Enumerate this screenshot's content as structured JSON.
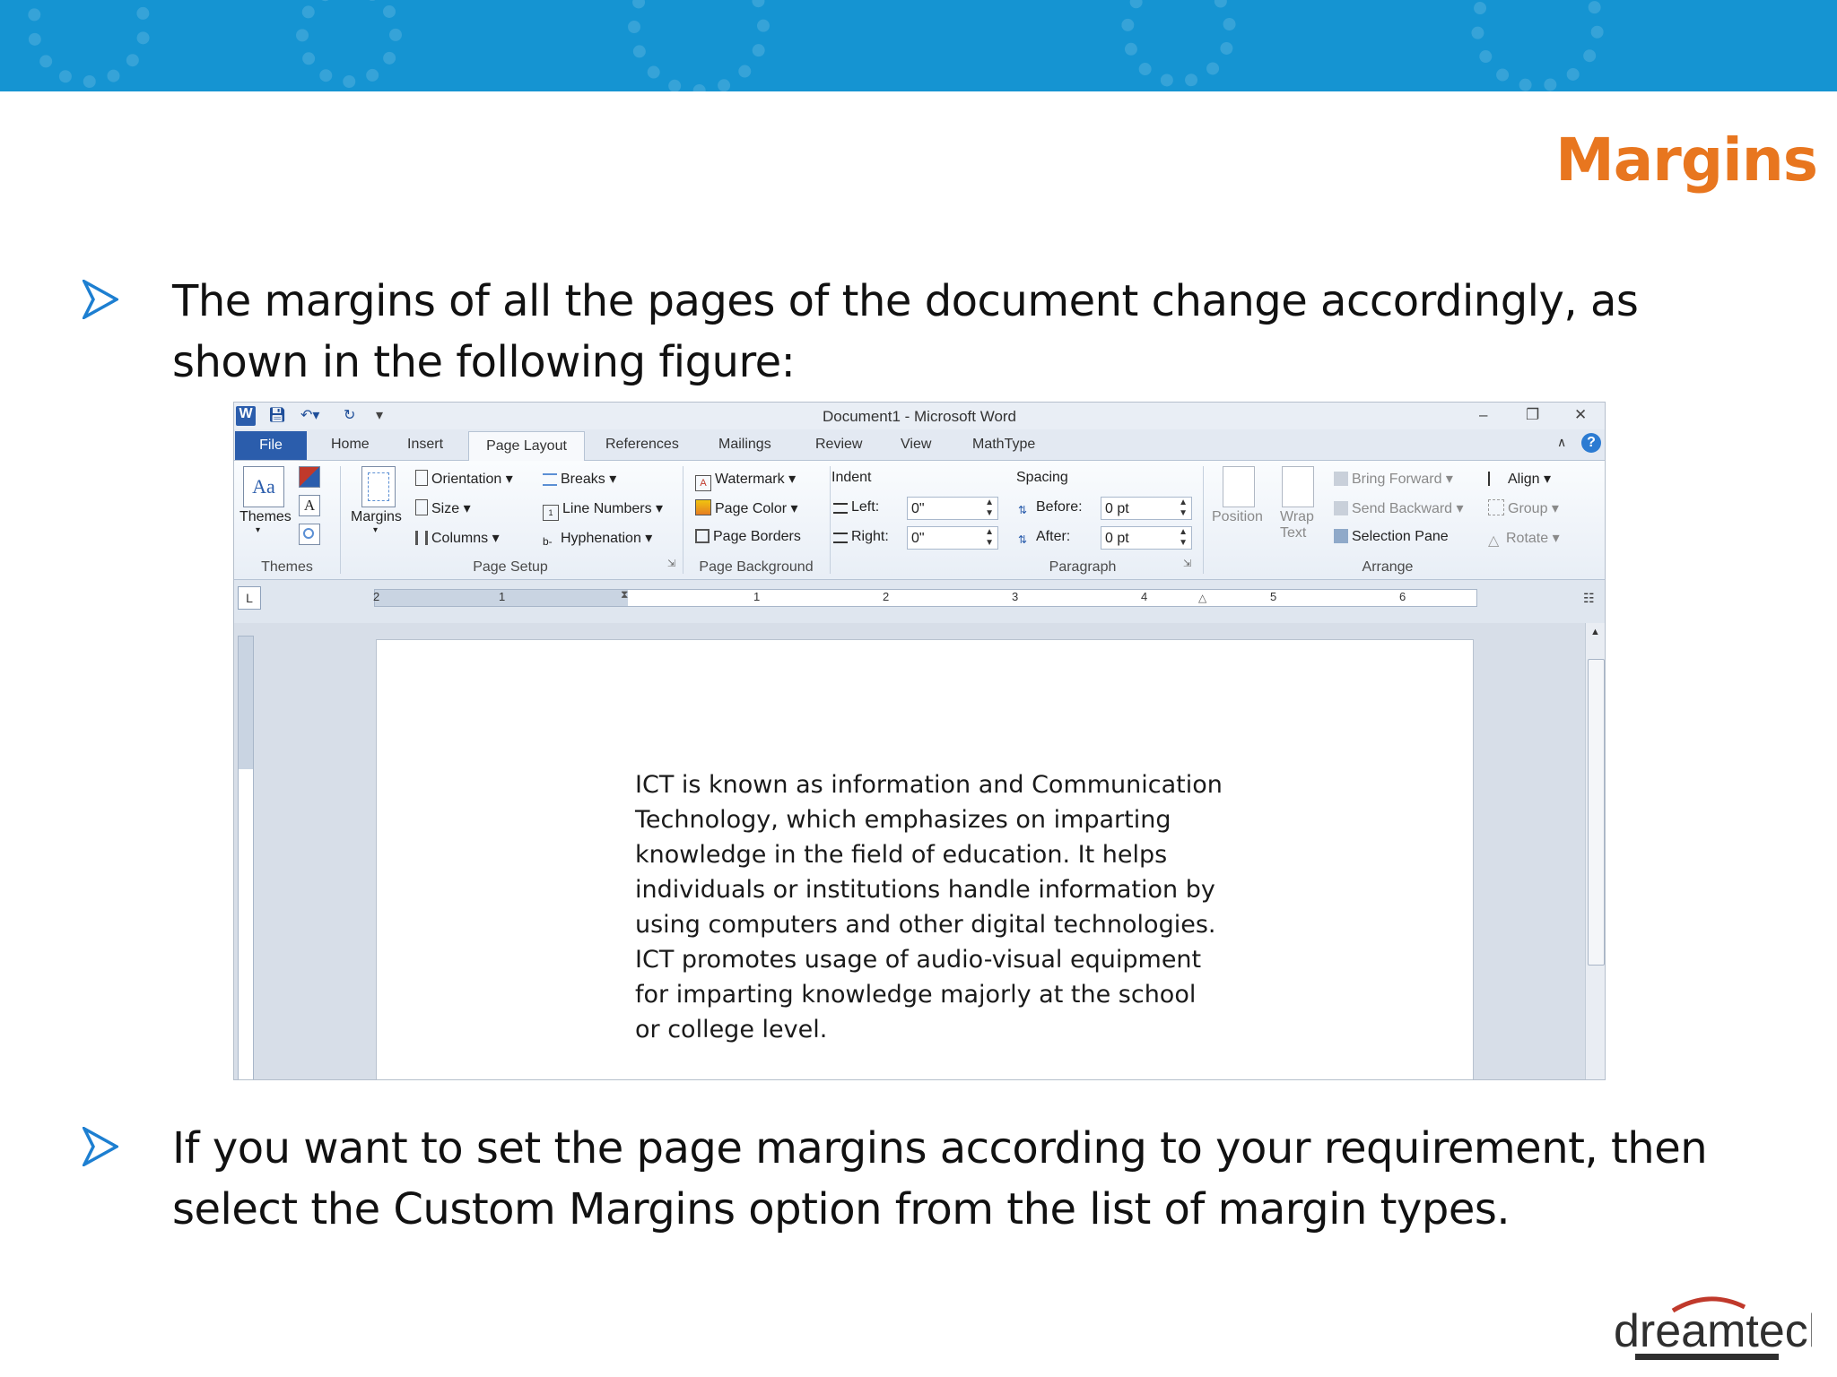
{
  "slide": {
    "title": "Margins",
    "bullets": [
      "The margins of all the pages of the document change accordingly, as shown in the following figure:",
      "If you want to set the page margins according to your requirement, then select the Custom Margins option from the list of margin types."
    ],
    "logo_text": "dreamtech",
    "colors": {
      "banner": "#1594d2",
      "title": "#e8761f",
      "bullet": "#1d7fd1"
    }
  },
  "word": {
    "window_title": "Document1  -  Microsoft Word",
    "tabs": {
      "file": "File",
      "home": "Home",
      "insert": "Insert",
      "page_layout": "Page Layout",
      "references": "References",
      "mailings": "Mailings",
      "review": "Review",
      "view": "View",
      "mathtype": "MathType"
    },
    "ribbon": {
      "themes": {
        "themes": "Themes",
        "group": "Themes"
      },
      "page_setup": {
        "margins": "Margins",
        "orientation": "Orientation",
        "size": "Size",
        "columns": "Columns",
        "breaks": "Breaks",
        "line_numbers": "Line Numbers",
        "hyphenation": "Hyphenation",
        "group": "Page Setup"
      },
      "page_background": {
        "watermark": "Watermark",
        "page_color": "Page Color",
        "page_borders": "Page Borders",
        "group": "Page Background"
      },
      "paragraph": {
        "indent": "Indent",
        "left_label": "Left:",
        "left_value": "0\"",
        "right_label": "Right:",
        "right_value": "0\"",
        "spacing": "Spacing",
        "before_label": "Before:",
        "before_value": "0 pt",
        "after_label": "After:",
        "after_value": "0 pt",
        "group": "Paragraph"
      },
      "arrange": {
        "position": "Position",
        "wrap_text": "Wrap",
        "wrap_text_2": "Text",
        "bring_forward": "Bring Forward",
        "send_backward": "Send Backward",
        "selection_pane": "Selection Pane",
        "align": "Align",
        "group_btn": "Group",
        "rotate": "Rotate",
        "group": "Arrange"
      }
    },
    "ruler_numbers": [
      "2",
      "1",
      "1",
      "2",
      "3",
      "4",
      "5",
      "6"
    ],
    "document_text": "ICT is known as information and Communication Technology, which emphasizes on imparting knowledge in the field of education. It helps individuals or institutions handle information by using computers and other digital technologies. ICT promotes usage of audio-visual equipment for imparting knowledge majorly at the school or college level."
  }
}
